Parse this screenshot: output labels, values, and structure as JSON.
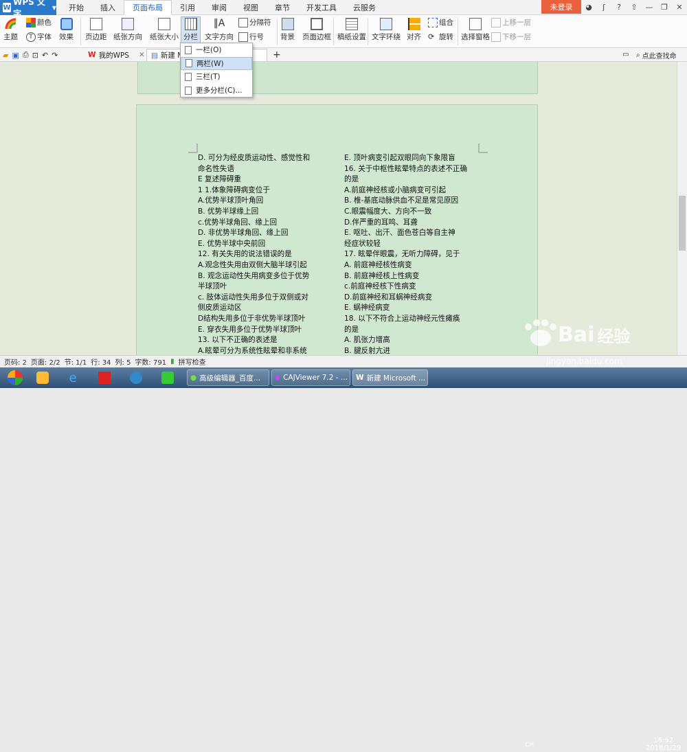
{
  "app": {
    "name": "WPS 文字",
    "logo": "W"
  },
  "menu_tabs": [
    "开始",
    "插入",
    "页面布局",
    "引用",
    "审阅",
    "视图",
    "章节",
    "开发工具",
    "云服务"
  ],
  "login_label": "未登录",
  "ribbon": {
    "theme": "主题",
    "color": "颜色",
    "font": "字体",
    "effect": "效果",
    "margins": "页边距",
    "orientation": "纸张方向",
    "size": "纸张大小",
    "columns": "分栏",
    "text_direction": "文字方向",
    "separator": "分隔符",
    "line_number": "行号",
    "background": "背景",
    "page_border": "页面边框",
    "draft": "稿纸设置",
    "wrap": "文字环绕",
    "align": "对齐",
    "rotate": "旋转",
    "group": "组合",
    "selection_pane": "选择窗格",
    "bring_forward": "上移一层",
    "send_backward": "下移一层"
  },
  "tabs": {
    "home": "我的WPS",
    "doc": "新建 Mi",
    "search": "点此查找命"
  },
  "dropdown": [
    "一栏(O)",
    "两栏(W)",
    "三栏(T)",
    "更多分栏(C)..."
  ],
  "doc": {
    "left": [
      "D. 可分为经皮质运动性、感觉性和",
      "命名性失语",
      "E 复述障碍重",
      "1 1.体象障碍病变位于",
      "A.优势半球顶叶角回",
      "B. 优势半球缘上回",
      "c.优势半球角回、缘上回",
      "D. 非优势半球角回、缘上回",
      "E. 优势半球中央前回",
      "12. 有关失用的说法错误的是",
      "A.观念性失用由双侧大脑半球引起",
      "B. 观念运动性失用病变多位于优势",
      "半球顶叶",
      "c. 肢体运动性失用多位于双侧或对",
      "侧皮质运动区",
      "D结构失用多位于非优势半球顶叶",
      "E. 穿衣失用多位于优势半球顶叶",
      "13. 以下不正确的表述是",
      "A.眩晕可分为系统性眩晕和非系统"
    ],
    "right": [
      "E. 顶叶病变引起双眼同向下象限盲",
      "16. 关于中枢性眩晕特点的表述不正确",
      "的是",
      "A.前庭神经核或小脑病变可引起",
      "B. 椎-基底动脉供血不足是常见原因",
      "C.眼震幅度大、方向不一致",
      "D.伴严重的耳鸣、耳聋",
      "E. 呕吐、出汗、面色苍白等自主神",
      "经症状较轻",
      "17. 眩晕伴眼震，无听力障碍，见于",
      "A. 前庭神经核性病变",
      "B. 前庭神经核上性病变",
      "c.前庭神经核下性病变",
      "D.前庭神经和耳蜗神经病变",
      "E. 蜗神经病变",
      "18. 以下不符合上运动神经元性瘫痪",
      "的是",
      "A. 肌张力增高",
      "B. 腱反射亢进"
    ]
  },
  "status": {
    "page": "页码: 2",
    "pages": "页面: 2/2",
    "section": "节: 1/1",
    "row": "行: 34",
    "col": "列: 5",
    "words": "字数: 791",
    "spell": "拼写检查"
  },
  "taskbar": {
    "item1": "高级编辑器_百度...",
    "item2": "CAJViewer 7.2 - ...",
    "item3": "新建 Microsoft ...",
    "time": "16:52",
    "date": "2018/1/29",
    "lang": "CH"
  },
  "watermark": {
    "brand": "Bai",
    "brand2": "经验",
    "url": "jingyan.baidu.com"
  },
  "colors": {
    "accent": "#2b79c9",
    "login": "#e8603c",
    "page_bg": "#cfe8cf"
  }
}
